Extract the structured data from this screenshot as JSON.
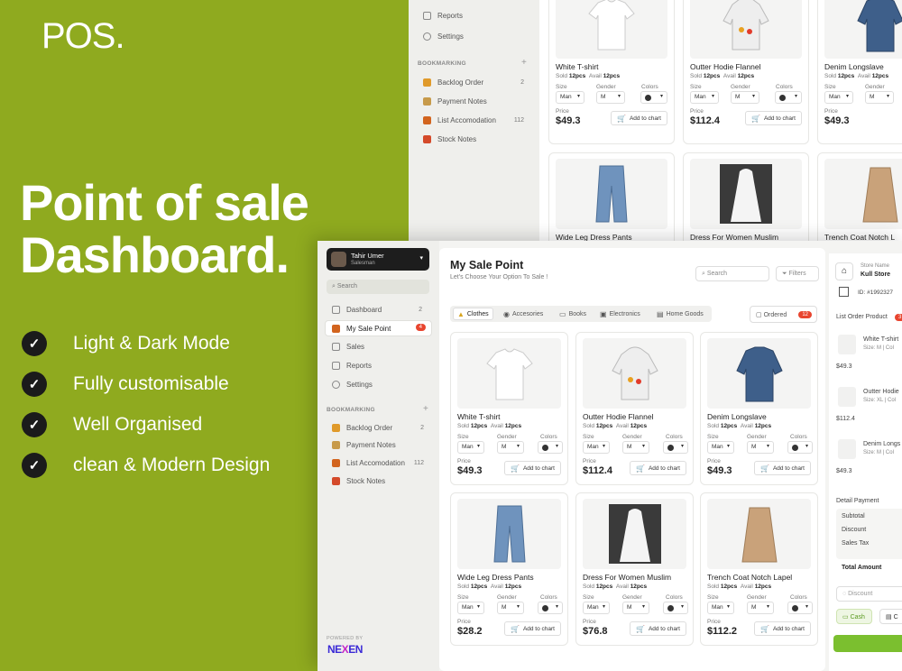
{
  "promo": {
    "brand": "POS.",
    "title_line1": "Point of sale",
    "title_line2": "Dashboard.",
    "features": [
      "Light & Dark Mode",
      "Fully customisable",
      "Well Organised",
      "clean & Modern Design"
    ]
  },
  "back_screen": {
    "nav": [
      {
        "label": "Reports",
        "icon": "document-icon"
      },
      {
        "label": "Settings",
        "icon": "gear-icon"
      }
    ],
    "bookmarking_label": "BOOKMARKING",
    "bookmarks": [
      {
        "label": "Backlog Order",
        "count": "2"
      },
      {
        "label": "Payment Notes",
        "count": ""
      },
      {
        "label": "List Accomodation",
        "count": "112"
      },
      {
        "label": "Stock Notes",
        "count": ""
      }
    ],
    "products_row1": [
      {
        "name": "White T-shirt",
        "sold": "12pcs",
        "avail": "12pcs",
        "size": "Man",
        "gender": "M",
        "price": "$49.3"
      },
      {
        "name": "Outter Hodie Flannel",
        "sold": "12pcs",
        "avail": "12pcs",
        "size": "Man",
        "gender": "M",
        "price": "$112.4"
      },
      {
        "name": "Denim Longslave",
        "sold": "12pcs",
        "avail": "12pcs",
        "size": "Man",
        "gender": "M",
        "price": "$49.3"
      }
    ],
    "products_row2": [
      {
        "name": "Wide Leg Dress Pants"
      },
      {
        "name": "Dress For Women Muslim"
      },
      {
        "name": "Trench Coat Notch L"
      }
    ]
  },
  "profile": {
    "name": "Tahir Umer",
    "role": "Salesman"
  },
  "sidebar": {
    "search_placeholder": "Search",
    "nav": [
      {
        "label": "Dashboard",
        "count": "2"
      },
      {
        "label": "My Sale Point",
        "count": "4"
      },
      {
        "label": "Sales",
        "count": ""
      },
      {
        "label": "Reports",
        "count": ""
      },
      {
        "label": "Settings",
        "count": ""
      }
    ],
    "bookmarking_label": "BOOKMARKING",
    "bookmarks": [
      {
        "label": "Backlog Order",
        "count": "2"
      },
      {
        "label": "Payment Notes",
        "count": ""
      },
      {
        "label": "List Accomodation",
        "count": "112"
      },
      {
        "label": "Stock Notes",
        "count": ""
      }
    ],
    "powered_by": "POWERED BY",
    "logo_left": "NE",
    "logo_x": "X",
    "logo_right": "EN"
  },
  "main": {
    "title": "My Sale Point",
    "subtitle": "Let's Choose Your Option To Sale !",
    "search_placeholder": "Search",
    "filters_label": "Filters",
    "tabs": [
      "Clothes",
      "Accesories",
      "Books",
      "Electronics",
      "Home Goods"
    ],
    "ordered_label": "Ordered",
    "ordered_count": "12",
    "labels": {
      "sold": "Sold",
      "avail": "Avail",
      "size": "Size",
      "gender": "Gender",
      "colors": "Colors",
      "price": "Price",
      "add_to_cart": "Add to chart"
    },
    "products": [
      {
        "name": "White T-shirt",
        "sold": "12pcs",
        "avail": "12pcs",
        "size": "Man",
        "gender": "M",
        "price": "$49.3",
        "color": "#ffffff"
      },
      {
        "name": "Outter Hodie Flannel",
        "sold": "12pcs",
        "avail": "12pcs",
        "size": "Man",
        "gender": "M",
        "price": "$112.4",
        "color": "#d8d8d8"
      },
      {
        "name": "Denim Longslave",
        "sold": "12pcs",
        "avail": "12pcs",
        "size": "Man",
        "gender": "M",
        "price": "$49.3",
        "color": "#3e5f8a"
      },
      {
        "name": "Wide Leg Dress Pants",
        "sold": "12pcs",
        "avail": "12pcs",
        "size": "Man",
        "gender": "M",
        "price": "$28.2",
        "color": "#6f93bd"
      },
      {
        "name": "Dress For Women Muslim",
        "sold": "12pcs",
        "avail": "12pcs",
        "size": "Man",
        "gender": "M",
        "price": "$76.8",
        "color": "#f2f2f2"
      },
      {
        "name": "Trench Coat Notch Lapel",
        "sold": "12pcs",
        "avail": "12pcs",
        "size": "Man",
        "gender": "M",
        "price": "$112.2",
        "color": "#c9a27a"
      }
    ]
  },
  "order_panel": {
    "store_name_label": "Store Name",
    "store_name": "Kull Store",
    "store_id": "ID: #1992327",
    "list_label": "List Order Product",
    "list_count": "3",
    "items": [
      {
        "name": "White T-shirt",
        "meta": "Size: M | Col",
        "price": "$49.3"
      },
      {
        "name": "Outter Hodie",
        "meta": "Size: XL | Col",
        "price": "$112.4"
      },
      {
        "name": "Denim Longs",
        "meta": "Size: M | Col",
        "price": "$49.3"
      }
    ],
    "detail_label": "Detail Payment",
    "subtotal_label": "Subtotal",
    "discount_label": "Discount",
    "tax_label": "Sales Tax",
    "total_label": "Total Amount",
    "discount_placeholder": "Discount",
    "cash_label": "Cash",
    "card_label": "C"
  },
  "colors": {
    "accent": "#8faa1f",
    "badge": "#e8452f",
    "pay": "#7bbf2f"
  }
}
